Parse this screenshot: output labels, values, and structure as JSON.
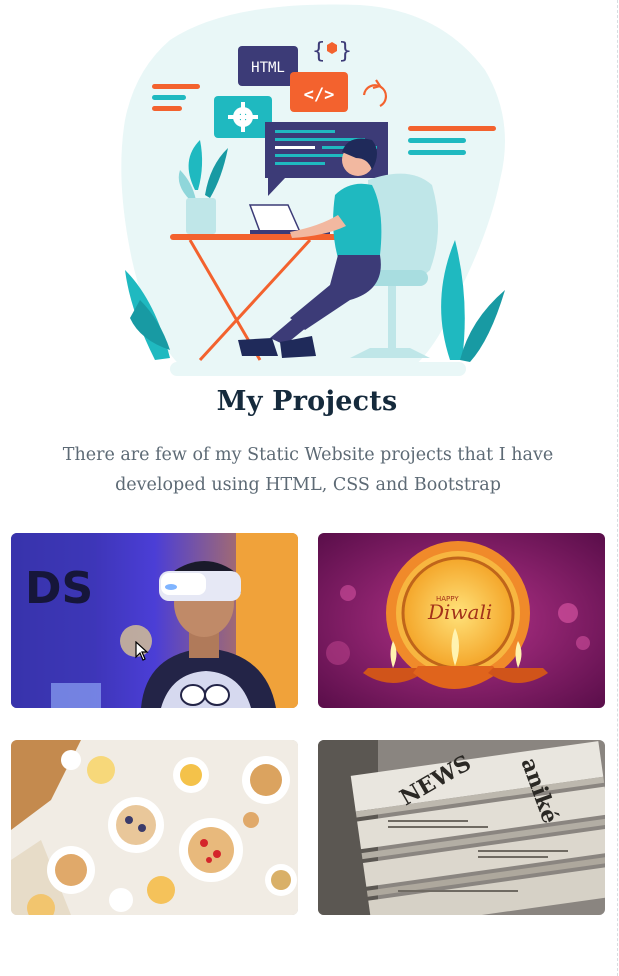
{
  "section": {
    "title": "My Projects",
    "subtitle_line1": "There are few of my Static Website projects that I have",
    "subtitle_line2": "developed using HTML, CSS and Bootstrap"
  },
  "hero_illustration": {
    "html_tag": "HTML",
    "code_icon": "</>",
    "braces_icon": "{ }",
    "colors": {
      "teal": "#1fb9c0",
      "orange": "#f3622e",
      "navy": "#3c3b77",
      "blob": "#e9f7f7"
    }
  },
  "projects": [
    {
      "name": "vr-headset-project",
      "image_icon": "vr-headset"
    },
    {
      "name": "diwali-project",
      "image_icon": "diwali-lamp",
      "card_text_1": "HAPPY",
      "card_text_2": "Diwali"
    },
    {
      "name": "food-project",
      "image_icon": "food-table"
    },
    {
      "name": "newspaper-project",
      "image_icon": "newspaper-stack"
    }
  ]
}
